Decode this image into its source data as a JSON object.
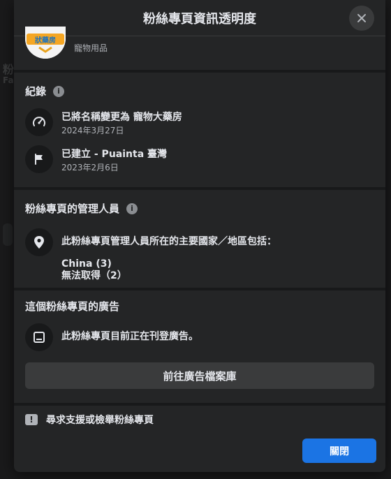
{
  "dialog": {
    "title": "粉絲專頁資訊透明度",
    "profile": {
      "category": "寵物用品",
      "logo_text": "寵物大藥房"
    },
    "history": {
      "title": "紀錄",
      "entries": [
        {
          "icon": "speedometer-icon",
          "text": "已將名稱變更為 寵物大藥房",
          "date": "2024年3月27日"
        },
        {
          "icon": "flag-icon",
          "text": "已建立 - Puainta 臺灣",
          "date": "2023年2月6日"
        }
      ]
    },
    "admins": {
      "title": "粉絲專頁的管理人員",
      "description": "此粉絲專頁管理人員所在的主要國家／地區包括：",
      "countries": [
        "China (3)",
        "無法取得（2）"
      ]
    },
    "ads": {
      "title": "這個粉絲專頁的廣告",
      "status": "此粉絲專頁目前正在刊登廣告。",
      "library_button": "前往廣告檔案庫"
    },
    "report_link": "尋求支援或檢舉粉絲專頁",
    "close_button": "關閉"
  },
  "background_fragments": [
    "粉",
    "Fa"
  ],
  "colors": {
    "primary": "#1b74e4",
    "surface": "#242526",
    "background": "#18191a"
  }
}
